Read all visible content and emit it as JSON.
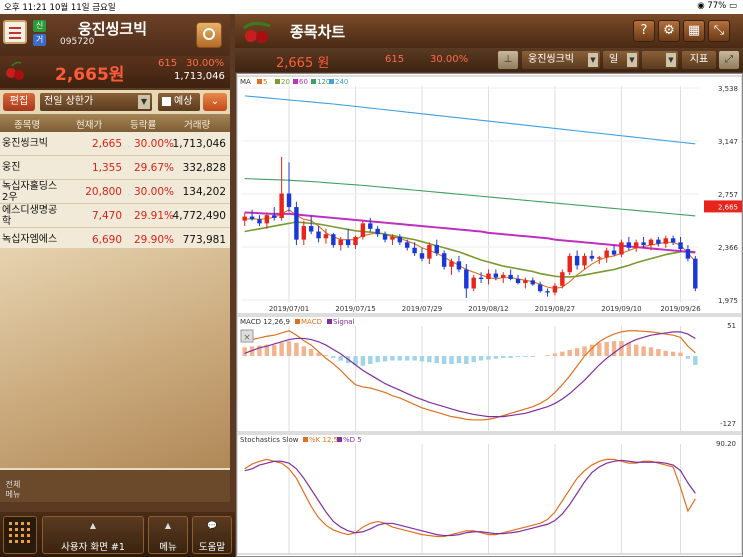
{
  "status_bar": {
    "time_date": "오후 11:21  10월 11일 금요일",
    "battery": "77%"
  },
  "left_panel": {
    "badges": {
      "new": "신",
      "geo": "거"
    },
    "stock_name": "웅진씽크빅",
    "stock_code": "095720",
    "price": "2,665원",
    "change": "615",
    "change_pct": "30.00%",
    "volume": "1,713,046",
    "edit_label": "편집",
    "condition_label": "전일 상한가",
    "predict_label": "예상",
    "columns": [
      "종목명",
      "현재가",
      "등락률",
      "거래량"
    ],
    "rows": [
      {
        "name": "웅진씽크빅",
        "price": "2,665",
        "pct": "30.00%",
        "volume": "1,713,046"
      },
      {
        "name": "웅진",
        "price": "1,355",
        "pct": "29.67%",
        "volume": "332,828"
      },
      {
        "name": "녹십자홀딩스 2우",
        "price": "20,800",
        "pct": "30.00%",
        "volume": "134,202"
      },
      {
        "name": "에스디생명공학",
        "price": "7,470",
        "pct": "29.91%",
        "volume": "4,772,490"
      },
      {
        "name": "녹십자엠에스",
        "price": "6,690",
        "pct": "29.90%",
        "volume": "773,981"
      }
    ],
    "full_menu_label": "전체메뉴"
  },
  "bottom_bar": {
    "user_screen": "사용자 화면 #1",
    "menu": "메뉴",
    "help": "도움말"
  },
  "right_panel": {
    "title": "종목차트",
    "price": "2,665 원",
    "change": "615",
    "change_pct": "30.00%",
    "stock_select": "웅진씽크빅",
    "period_select": "일",
    "indicator_btn": "지표",
    "header_icons": [
      "help-icon",
      "gear-icon",
      "grid-icon",
      "expand-icon"
    ]
  },
  "chart_data": [
    {
      "type": "candlestick",
      "title": "MA",
      "legend": [
        "5",
        "20",
        "60",
        "120",
        "240"
      ],
      "legend_colors": [
        "#e07020",
        "#7a9a30",
        "#c030c0",
        "#40a060",
        "#40a0e0"
      ],
      "x_ticks": [
        "2019/07/01",
        "2019/07/15",
        "2019/07/29",
        "2019/08/12",
        "2019/08/27",
        "2019/09/10",
        "2019/09/26"
      ],
      "y_ticks": [
        "3,538",
        "3,147",
        "2,757",
        "2,366",
        "1,975"
      ],
      "ylim": [
        1975,
        3538
      ],
      "current_price_label": "2,665",
      "candles": [
        {
          "o": 2560,
          "h": 2620,
          "l": 2520,
          "c": 2590
        },
        {
          "o": 2590,
          "h": 2640,
          "l": 2560,
          "c": 2570
        },
        {
          "o": 2570,
          "h": 2600,
          "l": 2520,
          "c": 2540
        },
        {
          "o": 2540,
          "h": 2620,
          "l": 2500,
          "c": 2600
        },
        {
          "o": 2600,
          "h": 2660,
          "l": 2560,
          "c": 2580
        },
        {
          "o": 2580,
          "h": 3030,
          "l": 2560,
          "c": 2760
        },
        {
          "o": 2760,
          "h": 2990,
          "l": 2620,
          "c": 2660
        },
        {
          "o": 2660,
          "h": 2700,
          "l": 2380,
          "c": 2420
        },
        {
          "o": 2420,
          "h": 2560,
          "l": 2380,
          "c": 2520
        },
        {
          "o": 2520,
          "h": 2600,
          "l": 2460,
          "c": 2480
        },
        {
          "o": 2480,
          "h": 2520,
          "l": 2400,
          "c": 2430
        },
        {
          "o": 2430,
          "h": 2500,
          "l": 2390,
          "c": 2460
        },
        {
          "o": 2460,
          "h": 2470,
          "l": 2360,
          "c": 2380
        },
        {
          "o": 2380,
          "h": 2440,
          "l": 2340,
          "c": 2420
        },
        {
          "o": 2420,
          "h": 2500,
          "l": 2360,
          "c": 2380
        },
        {
          "o": 2380,
          "h": 2450,
          "l": 2350,
          "c": 2440
        },
        {
          "o": 2440,
          "h": 2560,
          "l": 2420,
          "c": 2540
        },
        {
          "o": 2540,
          "h": 2580,
          "l": 2480,
          "c": 2500
        },
        {
          "o": 2500,
          "h": 2520,
          "l": 2440,
          "c": 2460
        },
        {
          "o": 2460,
          "h": 2480,
          "l": 2400,
          "c": 2420
        },
        {
          "o": 2420,
          "h": 2460,
          "l": 2380,
          "c": 2440
        },
        {
          "o": 2440,
          "h": 2460,
          "l": 2380,
          "c": 2400
        },
        {
          "o": 2400,
          "h": 2420,
          "l": 2340,
          "c": 2360
        },
        {
          "o": 2360,
          "h": 2400,
          "l": 2300,
          "c": 2320
        },
        {
          "o": 2320,
          "h": 2360,
          "l": 2260,
          "c": 2280
        },
        {
          "o": 2280,
          "h": 2400,
          "l": 2240,
          "c": 2380
        },
        {
          "o": 2380,
          "h": 2420,
          "l": 2300,
          "c": 2320
        },
        {
          "o": 2320,
          "h": 2340,
          "l": 2200,
          "c": 2220
        },
        {
          "o": 2220,
          "h": 2280,
          "l": 2160,
          "c": 2260
        },
        {
          "o": 2260,
          "h": 2300,
          "l": 2180,
          "c": 2200
        },
        {
          "o": 2200,
          "h": 2240,
          "l": 1990,
          "c": 2060
        },
        {
          "o": 2060,
          "h": 2160,
          "l": 2040,
          "c": 2140
        },
        {
          "o": 2140,
          "h": 2180,
          "l": 2100,
          "c": 2130
        },
        {
          "o": 2130,
          "h": 2200,
          "l": 2090,
          "c": 2170
        },
        {
          "o": 2170,
          "h": 2200,
          "l": 2120,
          "c": 2140
        },
        {
          "o": 2140,
          "h": 2180,
          "l": 2100,
          "c": 2160
        },
        {
          "o": 2160,
          "h": 2200,
          "l": 2120,
          "c": 2130
        },
        {
          "o": 2130,
          "h": 2160,
          "l": 2090,
          "c": 2100
        },
        {
          "o": 2100,
          "h": 2140,
          "l": 2060,
          "c": 2120
        },
        {
          "o": 2120,
          "h": 2140,
          "l": 2080,
          "c": 2090
        },
        {
          "o": 2090,
          "h": 2110,
          "l": 2030,
          "c": 2040
        },
        {
          "o": 2040,
          "h": 2060,
          "l": 2000,
          "c": 2030
        },
        {
          "o": 2030,
          "h": 2100,
          "l": 2010,
          "c": 2080
        },
        {
          "o": 2080,
          "h": 2200,
          "l": 2060,
          "c": 2180
        },
        {
          "o": 2180,
          "h": 2320,
          "l": 2160,
          "c": 2300
        },
        {
          "o": 2300,
          "h": 2340,
          "l": 2200,
          "c": 2230
        },
        {
          "o": 2230,
          "h": 2320,
          "l": 2200,
          "c": 2300
        },
        {
          "o": 2300,
          "h": 2340,
          "l": 2260,
          "c": 2280
        },
        {
          "o": 2280,
          "h": 2300,
          "l": 2240,
          "c": 2290
        },
        {
          "o": 2290,
          "h": 2360,
          "l": 2250,
          "c": 2340
        },
        {
          "o": 2340,
          "h": 2380,
          "l": 2300,
          "c": 2310
        },
        {
          "o": 2310,
          "h": 2420,
          "l": 2290,
          "c": 2400
        },
        {
          "o": 2400,
          "h": 2440,
          "l": 2340,
          "c": 2360
        },
        {
          "o": 2360,
          "h": 2420,
          "l": 2330,
          "c": 2400
        },
        {
          "o": 2400,
          "h": 2440,
          "l": 2360,
          "c": 2380
        },
        {
          "o": 2380,
          "h": 2430,
          "l": 2340,
          "c": 2420
        },
        {
          "o": 2420,
          "h": 2440,
          "l": 2370,
          "c": 2390
        },
        {
          "o": 2390,
          "h": 2450,
          "l": 2360,
          "c": 2430
        },
        {
          "o": 2430,
          "h": 2450,
          "l": 2380,
          "c": 2400
        },
        {
          "o": 2400,
          "h": 2440,
          "l": 2330,
          "c": 2350
        },
        {
          "o": 2350,
          "h": 2380,
          "l": 2260,
          "c": 2280
        },
        {
          "o": 2280,
          "h": 2300,
          "l": 2040,
          "c": 2060
        }
      ],
      "ma_lines": [
        {
          "name": "5",
          "values": [
            2570,
            2575,
            2570,
            2575,
            2585,
            2610,
            2640,
            2600,
            2570,
            2560,
            2520,
            2470,
            2440,
            2420,
            2420,
            2420,
            2450,
            2460,
            2470,
            2460,
            2440,
            2430,
            2410,
            2390,
            2360,
            2340,
            2320,
            2290,
            2260,
            2230,
            2200,
            2180,
            2160,
            2140,
            2130,
            2140,
            2140,
            2130,
            2120,
            2110,
            2090,
            2070,
            2060,
            2070,
            2110,
            2160,
            2200,
            2240,
            2270,
            2290,
            2300,
            2320,
            2340,
            2360,
            2370,
            2380,
            2390,
            2400,
            2400,
            2380,
            2320,
            2260
          ]
        },
        {
          "name": "20",
          "values": [
            2480,
            2490,
            2500,
            2510,
            2520,
            2530,
            2540,
            2550,
            2545,
            2540,
            2535,
            2525,
            2515,
            2505,
            2495,
            2485,
            2480,
            2475,
            2470,
            2460,
            2450,
            2440,
            2430,
            2420,
            2405,
            2390,
            2375,
            2360,
            2345,
            2330,
            2310,
            2290,
            2270,
            2255,
            2240,
            2225,
            2215,
            2205,
            2195,
            2185,
            2170,
            2160,
            2150,
            2145,
            2145,
            2150,
            2160,
            2170,
            2180,
            2190,
            2200,
            2215,
            2230,
            2250,
            2265,
            2280,
            2295,
            2310,
            2320,
            2330,
            2335,
            2330
          ]
        },
        {
          "name": "60",
          "values": [
            2620,
            2618,
            2615,
            2612,
            2610,
            2610,
            2610,
            2605,
            2600,
            2595,
            2590,
            2585,
            2580,
            2575,
            2570,
            2565,
            2560,
            2555,
            2550,
            2545,
            2540,
            2535,
            2530,
            2525,
            2520,
            2515,
            2510,
            2505,
            2500,
            2495,
            2490,
            2485,
            2480,
            2470,
            2465,
            2460,
            2455,
            2450,
            2445,
            2440,
            2435,
            2430,
            2420,
            2415,
            2410,
            2405,
            2400,
            2395,
            2390,
            2385,
            2380,
            2375,
            2370,
            2365,
            2360,
            2355,
            2350,
            2345,
            2340,
            2335,
            2330,
            2325
          ]
        },
        {
          "name": "120",
          "values": [
            2870,
            2868,
            2866,
            2864,
            2862,
            2860,
            2858,
            2855,
            2852,
            2848,
            2845,
            2840,
            2836,
            2832,
            2828,
            2824,
            2820,
            2815,
            2810,
            2805,
            2800,
            2795,
            2790,
            2785,
            2780,
            2775,
            2770,
            2765,
            2760,
            2755,
            2750,
            2745,
            2740,
            2735,
            2730,
            2725,
            2720,
            2715,
            2710,
            2705,
            2700,
            2695,
            2690,
            2685,
            2680,
            2675,
            2670,
            2665,
            2660,
            2655,
            2650,
            2645,
            2640,
            2635,
            2630,
            2625,
            2620,
            2615,
            2610,
            2605,
            2600,
            2595
          ]
        },
        {
          "name": "240",
          "values": [
            3480,
            3475,
            3470,
            3465,
            3460,
            3455,
            3450,
            3445,
            3440,
            3435,
            3430,
            3425,
            3420,
            3414,
            3408,
            3402,
            3396,
            3390,
            3384,
            3378,
            3372,
            3366,
            3360,
            3354,
            3348,
            3342,
            3336,
            3330,
            3324,
            3318,
            3312,
            3306,
            3300,
            3294,
            3288,
            3282,
            3276,
            3270,
            3264,
            3258,
            3252,
            3246,
            3240,
            3234,
            3228,
            3222,
            3216,
            3210,
            3204,
            3198,
            3192,
            3186,
            3180,
            3174,
            3168,
            3162,
            3156,
            3150,
            3144,
            3138,
            3132,
            3126
          ]
        }
      ]
    },
    {
      "type": "line",
      "title": "MACD 12,26,9",
      "legend": [
        "MACD",
        "Signal"
      ],
      "legend_colors": [
        "#e07020",
        "#8030a0"
      ],
      "y_ticks": [
        "51",
        "-127"
      ],
      "ylim": [
        -127,
        51
      ],
      "histogram": [
        20,
        22,
        24,
        26,
        25,
        30,
        34,
        30,
        22,
        16,
        8,
        2,
        -4,
        -10,
        -16,
        -20,
        -22,
        -18,
        -14,
        -12,
        -10,
        -10,
        -10,
        -10,
        -12,
        -14,
        -16,
        -18,
        -18,
        -16,
        -18,
        -14,
        -10,
        -8,
        -6,
        -4,
        -4,
        -2,
        -2,
        -2,
        0,
        2,
        6,
        10,
        14,
        18,
        22,
        26,
        30,
        32,
        34,
        34,
        30,
        26,
        22,
        20,
        16,
        12,
        10,
        8,
        -6,
        -20
      ],
      "macd": [
        25,
        30,
        33,
        36,
        38,
        42,
        46,
        38,
        28,
        20,
        8,
        -4,
        -14,
        -26,
        -40,
        -52,
        -56,
        -58,
        -62,
        -66,
        -72,
        -76,
        -82,
        -88,
        -94,
        -98,
        -102,
        -106,
        -110,
        -112,
        -115,
        -116,
        -116,
        -115,
        -112,
        -108,
        -104,
        -100,
        -96,
        -92,
        -86,
        -78,
        -66,
        -52,
        -36,
        -18,
        0,
        14,
        26,
        34,
        40,
        44,
        46,
        46,
        45,
        44,
        42,
        40,
        38,
        34,
        18,
        6
      ],
      "signal": [
        5,
        10,
        15,
        18,
        22,
        26,
        30,
        32,
        32,
        30,
        26,
        20,
        12,
        4,
        -6,
        -16,
        -26,
        -34,
        -42,
        -50,
        -56,
        -62,
        -68,
        -74,
        -79,
        -84,
        -88,
        -92,
        -96,
        -100,
        -103,
        -106,
        -108,
        -110,
        -110,
        -110,
        -108,
        -106,
        -104,
        -100,
        -96,
        -92,
        -86,
        -78,
        -68,
        -56,
        -44,
        -30,
        -16,
        -4,
        6,
        16,
        24,
        30,
        34,
        38,
        40,
        42,
        44,
        44,
        40,
        32
      ]
    },
    {
      "type": "line",
      "title": "Stochastics Slow",
      "legend": [
        "%K 12,5",
        "%D 5"
      ],
      "legend_colors": [
        "#e07020",
        "#8030a0"
      ],
      "y_ticks": [
        "90.20"
      ],
      "ylim": [
        0,
        100
      ],
      "k": [
        80,
        85,
        88,
        90,
        88,
        86,
        80,
        70,
        55,
        40,
        28,
        20,
        15,
        12,
        10,
        12,
        18,
        22,
        24,
        22,
        18,
        16,
        14,
        12,
        10,
        9,
        8,
        8,
        10,
        12,
        14,
        14,
        12,
        10,
        10,
        12,
        14,
        16,
        18,
        20,
        22,
        26,
        34,
        46,
        58,
        70,
        78,
        84,
        88,
        90,
        90,
        88,
        86,
        86,
        88,
        88,
        86,
        84,
        82,
        60,
        35,
        48
      ],
      "d": [
        78,
        80,
        84,
        86,
        88,
        88,
        86,
        80,
        70,
        58,
        46,
        34,
        24,
        18,
        14,
        12,
        13,
        16,
        20,
        22,
        22,
        20,
        18,
        16,
        14,
        12,
        10,
        9,
        9,
        10,
        12,
        13,
        13,
        12,
        11,
        11,
        12,
        13,
        15,
        17,
        19,
        21,
        25,
        32,
        42,
        54,
        66,
        76,
        82,
        86,
        88,
        89,
        88,
        87,
        87,
        87,
        87,
        86,
        84,
        78,
        65,
        54
      ]
    }
  ]
}
